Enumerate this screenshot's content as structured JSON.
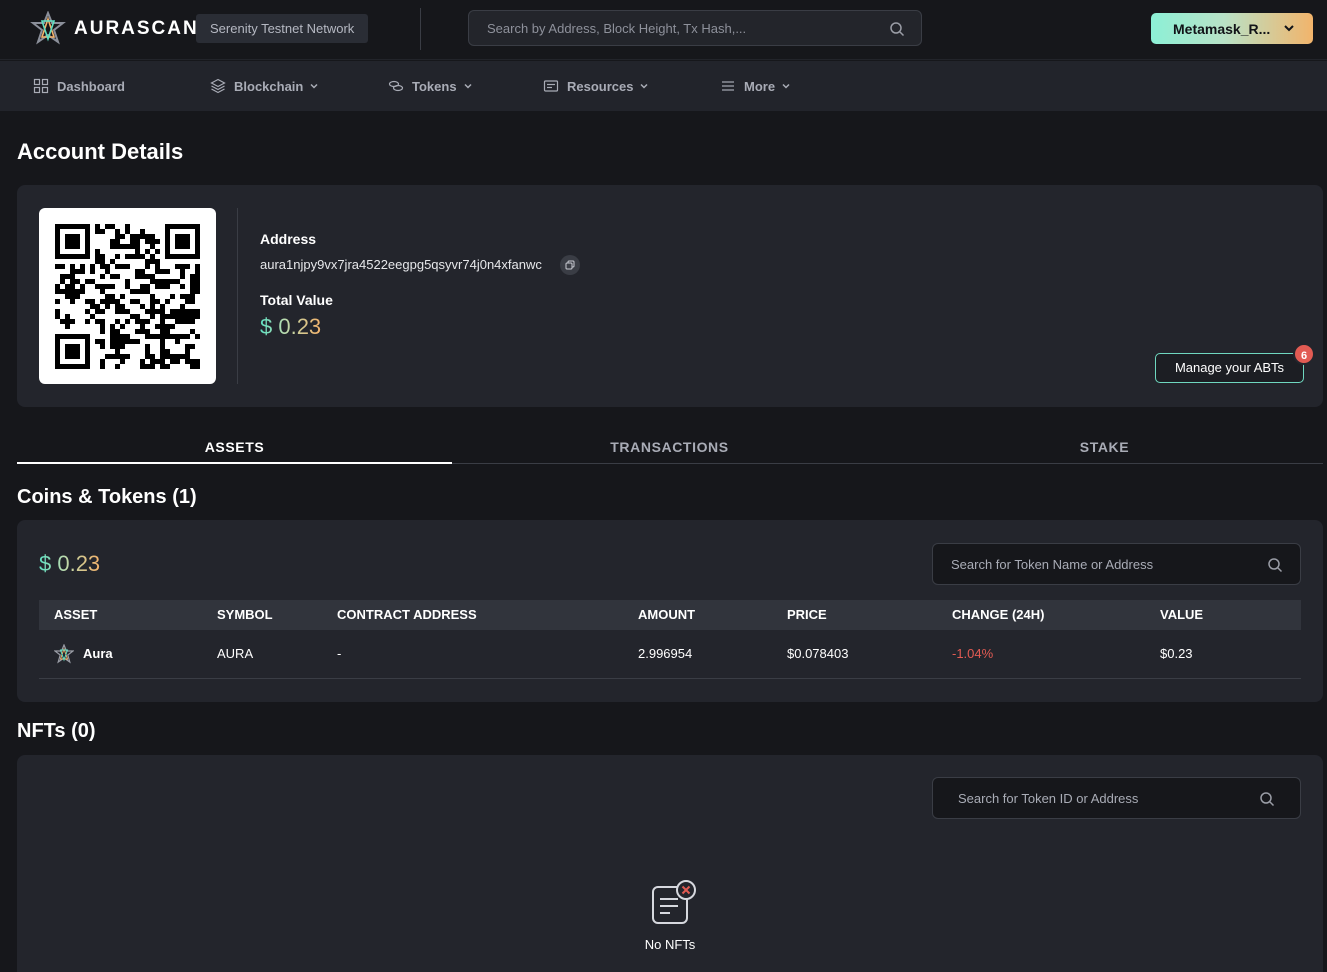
{
  "header": {
    "brand": "AURASCAN",
    "network": "Serenity Testnet Network",
    "search_placeholder": "Search by Address, Block Height, Tx Hash,...",
    "wallet_label": "Metamask_R..."
  },
  "nav": {
    "items": [
      {
        "label": "Dashboard",
        "icon": "dashboard-icon"
      },
      {
        "label": "Blockchain",
        "icon": "blockchain-icon"
      },
      {
        "label": "Tokens",
        "icon": "tokens-icon"
      },
      {
        "label": "Resources",
        "icon": "resources-icon"
      },
      {
        "label": "More",
        "icon": "menu-icon"
      }
    ]
  },
  "account": {
    "page_title": "Account Details",
    "address_label": "Address",
    "address": "aura1njpy9vx7jra4522eegpg5qsyvr74j0n4xfanwc",
    "total_value_label": "Total Value",
    "total_value": "$ 0.23",
    "manage_button": "Manage your ABTs",
    "manage_badge": "6"
  },
  "tabs": [
    {
      "label": "ASSETS",
      "active": true
    },
    {
      "label": "TRANSACTIONS",
      "active": false
    },
    {
      "label": "STAKE",
      "active": false
    }
  ],
  "coins": {
    "title": "Coins & Tokens (1)",
    "total": "$ 0.23",
    "search_placeholder": "Search for Token Name or Address",
    "columns": [
      "ASSET",
      "SYMBOL",
      "CONTRACT ADDRESS",
      "AMOUNT",
      "PRICE",
      "CHANGE (24H)",
      "VALUE"
    ],
    "rows": [
      {
        "asset": "Aura",
        "symbol": "AURA",
        "contract": "-",
        "amount": "2.996954",
        "price": "$0.078403",
        "change": "-1.04%",
        "value": "$0.23"
      }
    ]
  },
  "nfts": {
    "title": "NFTs (0)",
    "search_placeholder": "Search for Token ID or Address",
    "empty_text": "No NFTs"
  },
  "colors": {
    "accent_teal": "#5fe0c2",
    "accent_orange": "#f3b26b",
    "negative": "#e25b53",
    "background": "#16171b",
    "card": "#23252c"
  }
}
